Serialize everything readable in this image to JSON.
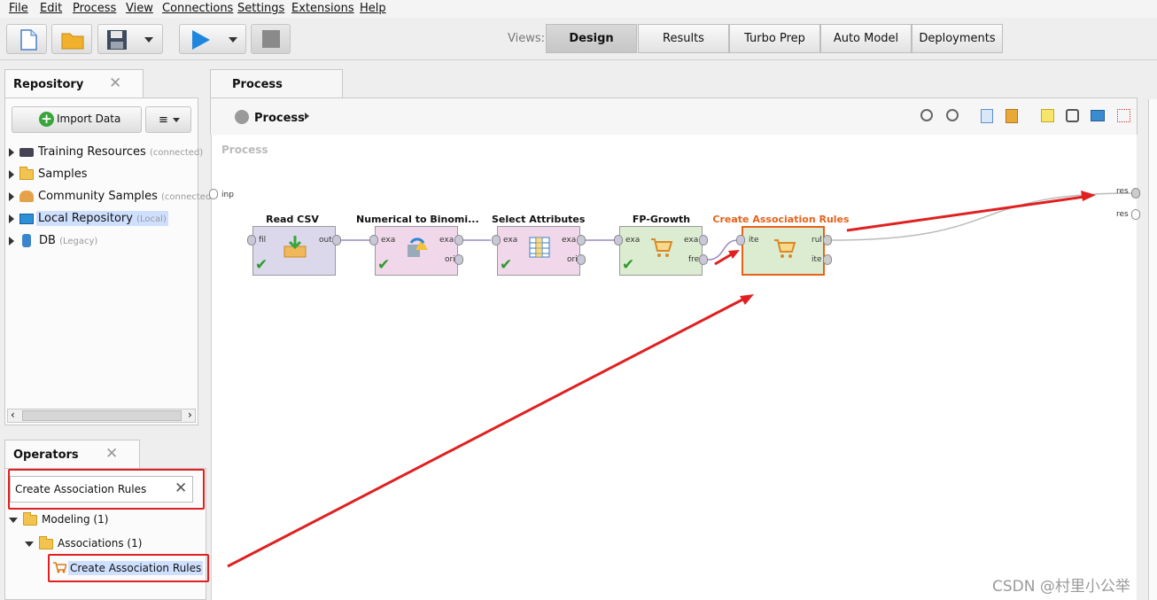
{
  "menu": [
    "File",
    "Edit",
    "Process",
    "View",
    "Connections",
    "Settings",
    "Extensions",
    "Help"
  ],
  "views": {
    "label": "Views:",
    "tabs": [
      "Design",
      "Results",
      "Turbo Prep",
      "Auto Model",
      "Deployments"
    ]
  },
  "repository": {
    "title": "Repository",
    "import_label": "Import Data",
    "items": [
      {
        "label": "Training Resources",
        "suffix": "(connected)"
      },
      {
        "label": "Samples",
        "suffix": ""
      },
      {
        "label": "Community Samples",
        "suffix": "(connected"
      },
      {
        "label": "Local Repository",
        "suffix": "(Local)"
      },
      {
        "label": "DB",
        "suffix": "(Legacy)"
      }
    ]
  },
  "operators": {
    "title": "Operators",
    "search_value": "Create Association Rules",
    "tree": {
      "modeling": "Modeling (1)",
      "associations": "Associations (1)",
      "leaf": "Create Association Rules"
    }
  },
  "process": {
    "tab_title": "Process",
    "breadcrumb": "Process",
    "canvas_label": "Process",
    "input_port": "inp",
    "result_ports": [
      "res",
      "res"
    ],
    "operators": [
      {
        "title": "Read CSV",
        "in": [
          "fil"
        ],
        "out": [
          "out"
        ],
        "color": "#dcd8ec"
      },
      {
        "title": "Numerical to Binomi...",
        "in": [
          "exa"
        ],
        "out": [
          "exa",
          "ori"
        ],
        "color": "#f0d8ea"
      },
      {
        "title": "Select Attributes",
        "in": [
          "exa"
        ],
        "out": [
          "exa",
          "ori"
        ],
        "color": "#f0d8ea"
      },
      {
        "title": "FP-Growth",
        "in": [
          "exa"
        ],
        "out": [
          "exa",
          "fre"
        ],
        "color": "#dcecd0"
      },
      {
        "title": "Create Association Rules",
        "in": [
          "ite"
        ],
        "out": [
          "rul",
          "ite"
        ],
        "color": "#dcecd0"
      }
    ]
  },
  "watermark": "CSDN @村里小公举",
  "colors": {
    "accent_orange": "#e8611a",
    "annotation_red": "#e02020",
    "check_green": "#2e9a2e"
  }
}
